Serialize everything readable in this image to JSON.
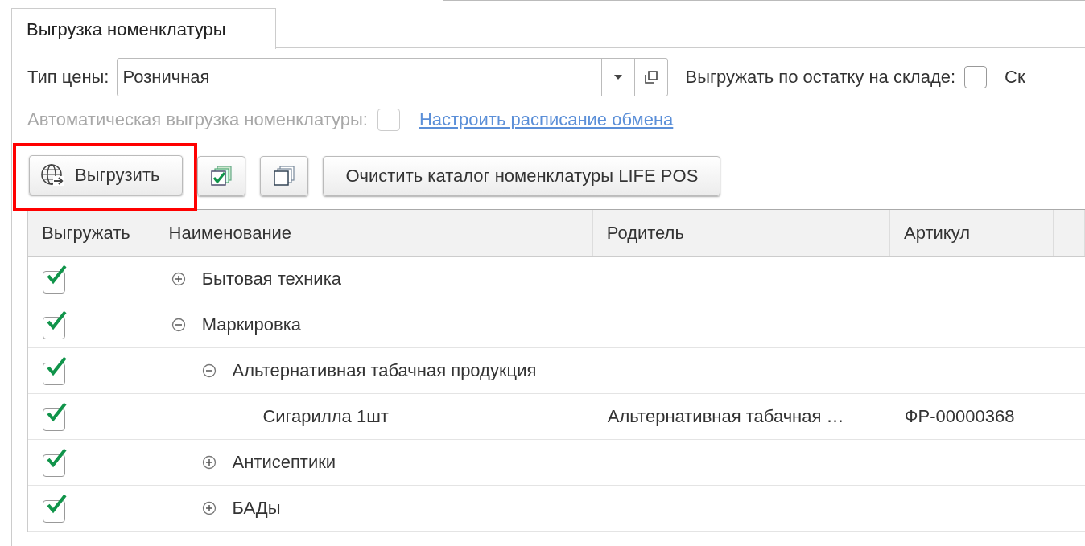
{
  "tab": {
    "label": "Выгрузка номенклатуры",
    "selected": true
  },
  "price_type": {
    "label": "Тип цены:",
    "value": "Розничная"
  },
  "stock_option": {
    "label": "Выгружать по остатку на складе:",
    "checked": false
  },
  "cut_label": "Ск",
  "auto_export": {
    "label": "Автоматическая выгрузка номенклатуры:",
    "checked": false,
    "disabled": true
  },
  "schedule_link": "Настроить расписание обмена",
  "toolbar": {
    "export_button": {
      "label": "Выгрузить",
      "highlighted": true
    },
    "clear_button": "Очистить каталог номенклатуры LIFE POS"
  },
  "table": {
    "columns": [
      "Выгружать",
      "Наименование",
      "Родитель",
      "Артикул"
    ],
    "rows": [
      {
        "name": "Бытовая техника",
        "checked": true,
        "expanded": false
      },
      {
        "name": "Маркировка",
        "checked": true,
        "expanded": true,
        "children": [
          {
            "name": "Альтернативная табачная продукция",
            "checked": true,
            "expanded": true,
            "children": [
              {
                "name": "Сигарилла 1шт",
                "checked": true,
                "parent": "Альтернативная табачная …",
                "article": "ФР-00000368"
              }
            ]
          },
          {
            "name": "Антисептики",
            "checked": true,
            "expanded": false
          },
          {
            "name": "БАДы",
            "checked": true,
            "expanded": false
          }
        ]
      }
    ]
  }
}
